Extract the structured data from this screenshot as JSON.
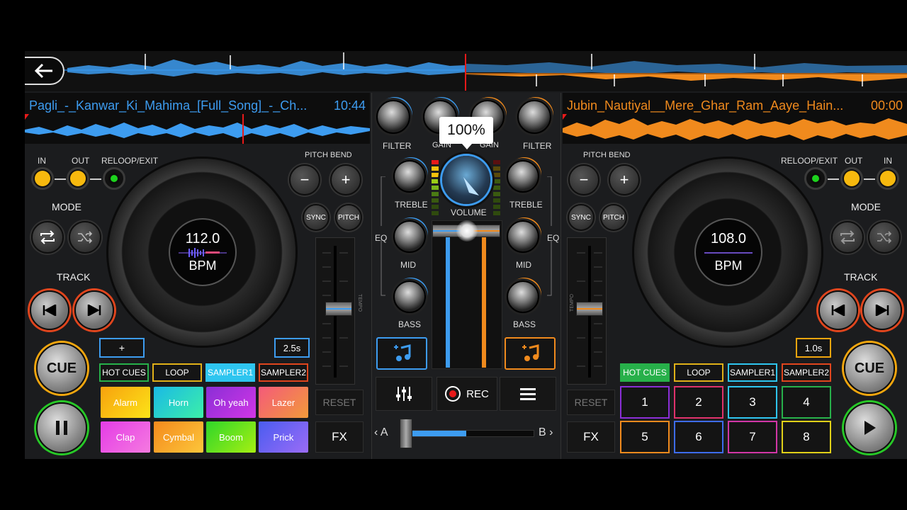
{
  "colors": {
    "deck_a": "#3d9cf0",
    "deck_b": "#f08a1d"
  },
  "overview": {
    "back_icon": "arrow-left"
  },
  "deck_a": {
    "title": "Pagli_-_Kanwar_Ki_Mahima_[Full_Song]_-_Ch...",
    "time": "10:44",
    "in": "IN",
    "out": "OUT",
    "reloop": "RELOOP/EXIT",
    "mode": "MODE",
    "track": "TRACK",
    "pitch_bend": "PITCH BEND",
    "minus": "−",
    "plus": "+",
    "sync": "SYNC",
    "pitch": "PITCH",
    "bpm_value": "112.0",
    "bpm_label": "BPM",
    "tempo": "TEMPO",
    "loop_plus": "+",
    "loop_len": "2.5s",
    "tabs": [
      "HOT CUES",
      "LOOP",
      "SAMPLER1",
      "SAMPLER2"
    ],
    "pads": [
      "Alarm",
      "Horn",
      "Oh yeah",
      "Lazer",
      "Clap",
      "Cymbal",
      "Boom",
      "Prick"
    ],
    "reset": "RESET",
    "fx": "FX",
    "cue": "CUE"
  },
  "deck_b": {
    "title": "Jubin_Nautiyal__Mere_Ghar_Ram_Aaye_Hain...",
    "time": "00:00",
    "in": "IN",
    "out": "OUT",
    "reloop": "RELOOP/EXIT",
    "mode": "MODE",
    "track": "TRACK",
    "pitch_bend": "PITCH BEND",
    "minus": "−",
    "plus": "+",
    "sync": "SYNC",
    "pitch": "PITCH",
    "bpm_value": "108.0",
    "bpm_label": "BPM",
    "tempo": "TEMPO",
    "loop_len": "1.0s",
    "tabs": [
      "HOT CUES",
      "LOOP",
      "SAMPLER1",
      "SAMPLER2"
    ],
    "pads": [
      "1",
      "2",
      "3",
      "4",
      "5",
      "6",
      "7",
      "8"
    ],
    "reset": "RESET",
    "fx": "FX",
    "cue": "CUE"
  },
  "mixer": {
    "filter": "FILTER",
    "gain": "GAIN",
    "treble": "TREBLE",
    "mid": "MID",
    "bass": "BASS",
    "eq": "EQ",
    "volume": "VOLUME",
    "volume_tooltip": "100%",
    "rec": "REC",
    "a": "A",
    "b": "B",
    "crossfader": 0.5
  }
}
